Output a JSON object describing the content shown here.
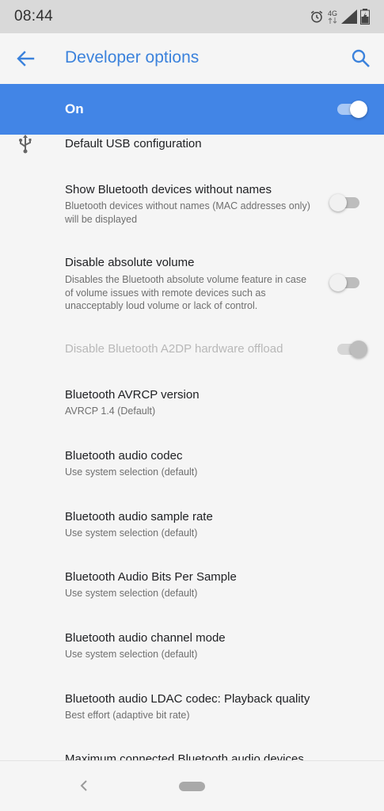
{
  "status_bar": {
    "time": "08:44",
    "network": "4G",
    "icons": [
      "alarm-icon",
      "signal-icon",
      "battery-icon"
    ]
  },
  "app_bar": {
    "title": "Developer options",
    "back_icon": "arrow-back-icon",
    "search_icon": "search-icon",
    "accent": "#3b82dc"
  },
  "master_switch": {
    "label": "On",
    "checked": true,
    "background": "#4285e6"
  },
  "settings": [
    {
      "title": "Default USB configuration",
      "icon": "usb-icon"
    },
    {
      "title": "Show Bluetooth devices without names",
      "summary": "Bluetooth devices without names (MAC addresses only) will be displayed",
      "switch": "off"
    },
    {
      "title": "Disable absolute volume",
      "summary": "Disables the Bluetooth absolute volume feature in case of volume issues with remote devices such as unacceptably loud volume or lack of control.",
      "switch": "off"
    },
    {
      "title": "Disable Bluetooth A2DP hardware offload",
      "switch": "disabled-on",
      "disabled": true
    },
    {
      "title": "Bluetooth AVRCP version",
      "summary": "AVRCP 1.4 (Default)"
    },
    {
      "title": "Bluetooth audio codec",
      "summary": "Use system selection (default)"
    },
    {
      "title": "Bluetooth audio sample rate",
      "summary": "Use system selection (default)"
    },
    {
      "title": "Bluetooth Audio Bits Per Sample",
      "summary": "Use system selection (default)"
    },
    {
      "title": "Bluetooth audio channel mode",
      "summary": "Use system selection (default)"
    },
    {
      "title": "Bluetooth audio LDAC codec: Playback quality",
      "summary": "Best effort (adaptive bit rate)"
    },
    {
      "title": "Maximum connected Bluetooth audio devices"
    }
  ],
  "nav_bar": {
    "icons": [
      "nav-back-icon",
      "home-pill-icon"
    ]
  }
}
